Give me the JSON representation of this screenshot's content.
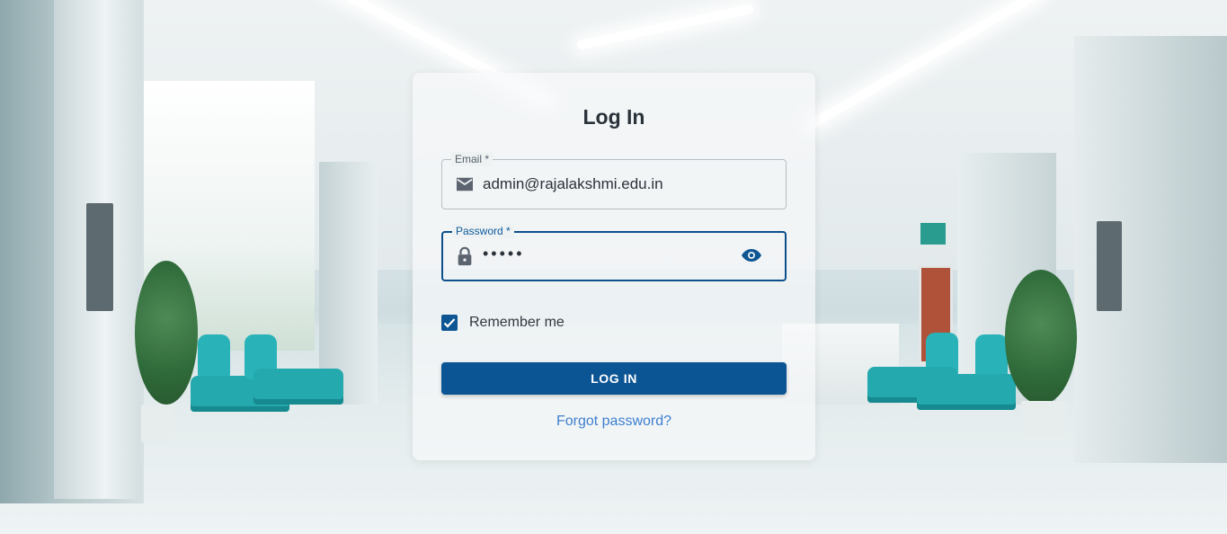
{
  "login_form": {
    "title": "Log In",
    "email": {
      "label": "Email *",
      "value": "admin@rajalakshmi.edu.in",
      "icon": "envelope-icon"
    },
    "password": {
      "label": "Password *",
      "value": "•••••",
      "icon": "lock-icon",
      "toggle_icon": "eye-icon"
    },
    "remember_me": {
      "label": "Remember me",
      "checked": true
    },
    "submit_label": "LOG IN",
    "forgot_password_label": "Forgot password?"
  },
  "colors": {
    "primary": "#0c5594",
    "link": "#3d7fd0",
    "title": "#2a323a",
    "background_accent": "#23a9ae"
  },
  "background": {
    "description_icon": "hospital-hallway-background"
  }
}
